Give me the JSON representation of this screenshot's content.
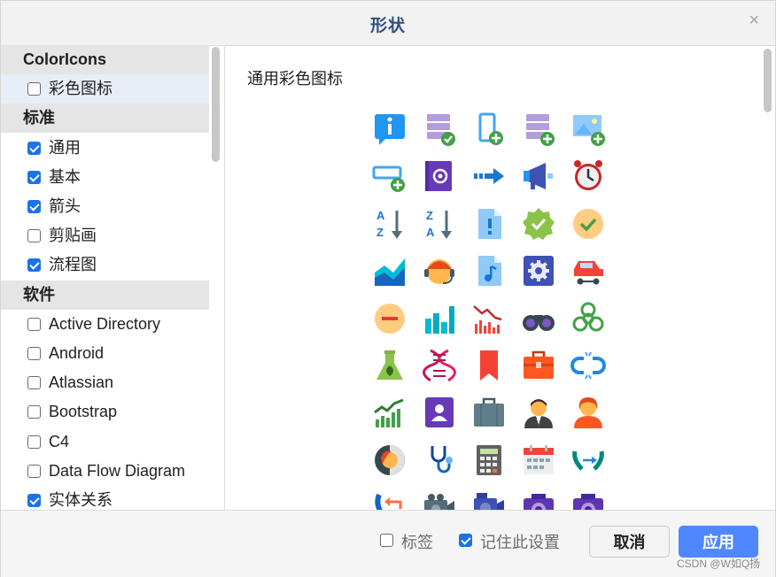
{
  "dialog": {
    "title": "形状",
    "close_label": "×"
  },
  "sidebar": {
    "sections": [
      {
        "header": "ColorIcons",
        "items": [
          {
            "label": "彩色图标",
            "checked": false,
            "highlight": true
          }
        ]
      },
      {
        "header": "标准",
        "items": [
          {
            "label": "通用",
            "checked": true
          },
          {
            "label": "基本",
            "checked": true
          },
          {
            "label": "箭头",
            "checked": true
          },
          {
            "label": "剪贴画",
            "checked": false
          },
          {
            "label": "流程图",
            "checked": true
          }
        ]
      },
      {
        "header": "软件",
        "items": [
          {
            "label": "Active Directory",
            "checked": false
          },
          {
            "label": "Android",
            "checked": false
          },
          {
            "label": "Atlassian",
            "checked": false
          },
          {
            "label": "Bootstrap",
            "checked": false
          },
          {
            "label": "C4",
            "checked": false
          },
          {
            "label": "Data Flow Diagram",
            "checked": false
          },
          {
            "label": "实体关系",
            "checked": true
          }
        ]
      }
    ]
  },
  "content": {
    "section_title": "通用彩色图标",
    "icons": [
      "info-icon",
      "database-check-icon",
      "phone-add-icon",
      "database-add-icon",
      "image-add-icon",
      "textbox-add-icon",
      "contact-book-icon",
      "right-arrow-icon",
      "megaphone-icon",
      "alarm-clock-icon",
      "sort-az-icon",
      "sort-za-icon",
      "document-alert-icon",
      "approval-badge-icon",
      "ok-face-icon",
      "area-chart-icon",
      "support-agent-icon",
      "music-file-icon",
      "settings-icon",
      "car-icon",
      "no-entry-face-icon",
      "bar-chart-icon",
      "declining-chart-icon",
      "binoculars-icon",
      "biohazard-icon",
      "test-flask-icon",
      "dna-icon",
      "bookmark-icon",
      "briefcase-icon",
      "broken-link-icon",
      "rising-chart-icon",
      "business-contact-icon",
      "suitcase-icon",
      "businessman-icon",
      "businesswoman-icon",
      "profile-side-icon",
      "stethoscope-icon",
      "calculator-icon",
      "calendar-icon",
      "call-transfer-icon",
      "callback-icon",
      "camcorder-icon",
      "camcorder-pro-icon",
      "camera-icon",
      "camera-addon-icon"
    ]
  },
  "footer": {
    "labels_checkbox": {
      "label": "标签",
      "checked": false
    },
    "remember_checkbox": {
      "label": "记住此设置",
      "checked": true
    },
    "cancel_label": "取消",
    "apply_label": "应用"
  },
  "watermark": "CSDN @W如Q扬",
  "colors": {
    "accent": "#1a73e8",
    "apply_button": "#4f87ff",
    "title_text": "#2f4f7f"
  }
}
